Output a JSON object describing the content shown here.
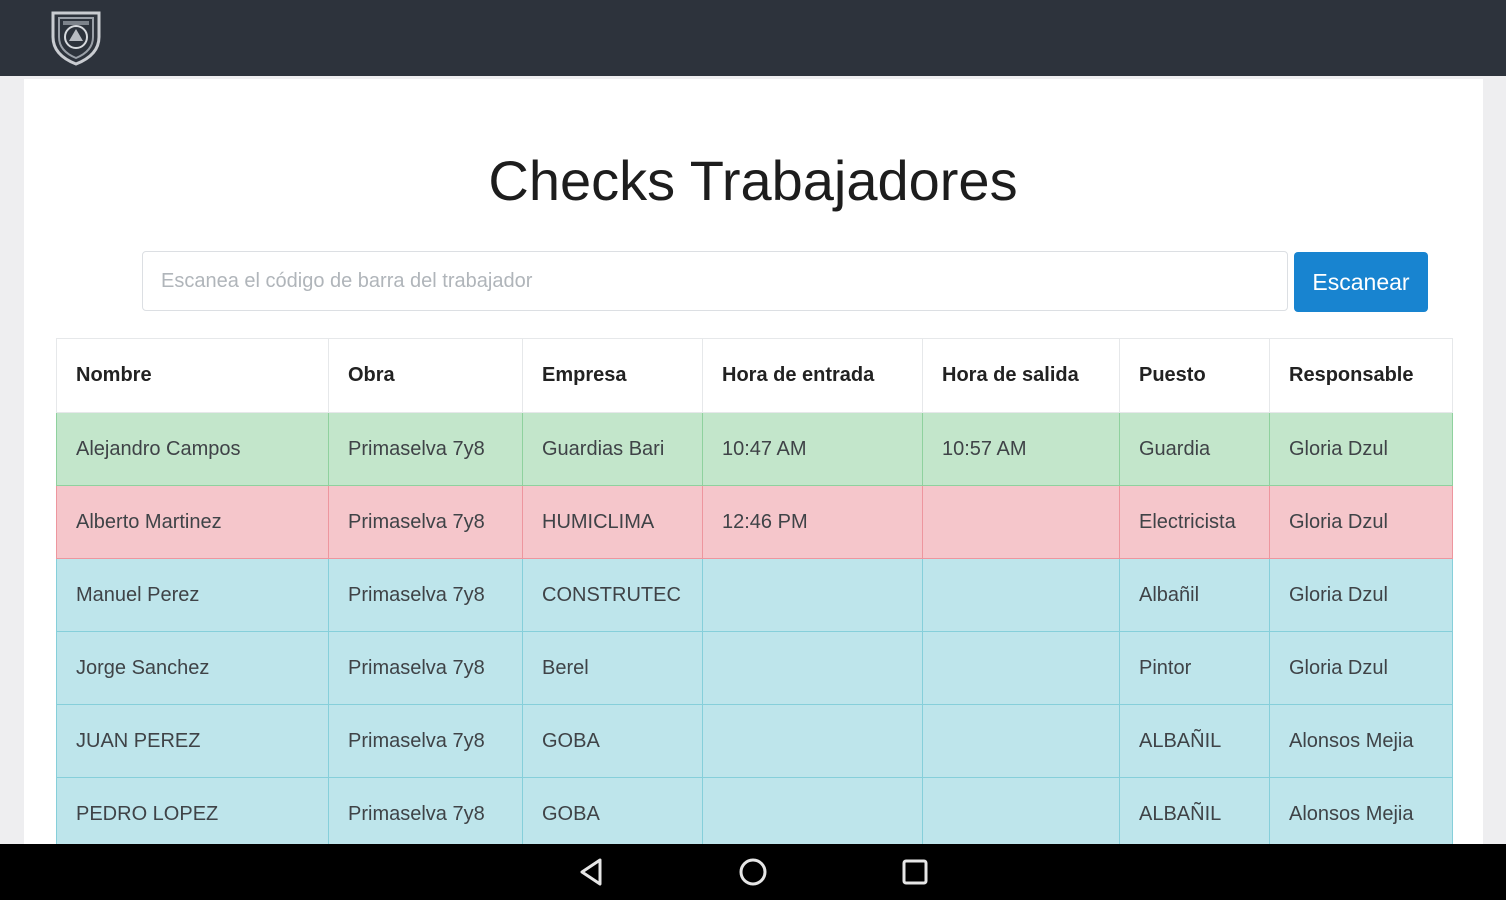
{
  "header": {
    "logo_icon": "shield-badge-icon",
    "bg_color": "#2d333c"
  },
  "page": {
    "title": "Checks Trabajadores"
  },
  "scanner": {
    "placeholder": "Escanea el código de barra del trabajador",
    "value": "",
    "button_label": "Escanear",
    "button_color": "#1884d0"
  },
  "table": {
    "columns": [
      "Nombre",
      "Obra",
      "Empresa",
      "Hora de entrada",
      "Hora de salida",
      "Puesto",
      "Responsable"
    ],
    "rows": [
      {
        "status": "success",
        "cells": [
          "Alejandro Campos",
          "Primaselva 7y8",
          "Guardias Bari",
          "10:47 AM",
          "10:57 AM",
          "Guardia",
          "Gloria Dzul"
        ]
      },
      {
        "status": "danger",
        "cells": [
          "Alberto Martinez",
          "Primaselva 7y8",
          "HUMICLIMA",
          "12:46 PM",
          "",
          "Electricista",
          "Gloria Dzul"
        ]
      },
      {
        "status": "info",
        "cells": [
          "Manuel Perez",
          "Primaselva 7y8",
          "CONSTRUTEC",
          "",
          "",
          "Albañil",
          "Gloria Dzul"
        ]
      },
      {
        "status": "info",
        "cells": [
          "Jorge Sanchez",
          "Primaselva 7y8",
          "Berel",
          "",
          "",
          "Pintor",
          "Gloria Dzul"
        ]
      },
      {
        "status": "info",
        "cells": [
          "JUAN PEREZ",
          "Primaselva 7y8",
          "GOBA",
          "",
          "",
          "ALBAÑIL",
          "Alonsos Mejia"
        ]
      },
      {
        "status": "info",
        "cells": [
          "PEDRO LOPEZ",
          "Primaselva 7y8",
          "GOBA",
          "",
          "",
          "ALBAÑIL",
          "Alonsos Mejia"
        ]
      }
    ],
    "status_colors": {
      "success": "#c3e6cb",
      "danger": "#f5c6cb",
      "info": "#bee5eb"
    }
  },
  "system_nav": {
    "back_icon": "back-triangle-icon",
    "home_icon": "home-circle-icon",
    "recents_icon": "recents-square-icon"
  }
}
